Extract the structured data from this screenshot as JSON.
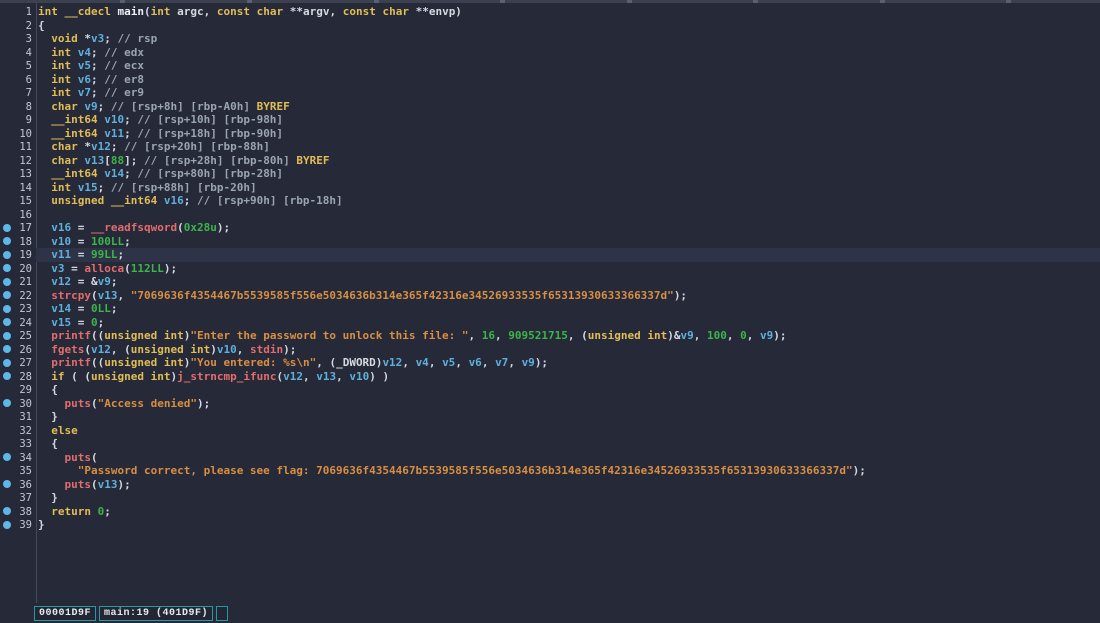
{
  "editor": {
    "current_line": 19,
    "breakpoints": [
      17,
      18,
      19,
      20,
      21,
      22,
      23,
      24,
      25,
      26,
      27,
      28,
      30,
      34,
      36,
      38,
      39
    ],
    "lines": [
      {
        "n": 1,
        "s": [
          [
            "kw",
            "int"
          ],
          [
            "pl",
            " "
          ],
          [
            "kw",
            "__cdecl"
          ],
          [
            "pl",
            " "
          ],
          [
            "mn",
            "main"
          ],
          [
            "pl",
            "("
          ],
          [
            "kw",
            "int"
          ],
          [
            "pl",
            " argc, "
          ],
          [
            "kw",
            "const"
          ],
          [
            "pl",
            " "
          ],
          [
            "kw",
            "char"
          ],
          [
            "pl",
            " **argv, "
          ],
          [
            "kw",
            "const"
          ],
          [
            "pl",
            " "
          ],
          [
            "kw",
            "char"
          ],
          [
            "pl",
            " **envp)"
          ]
        ]
      },
      {
        "n": 2,
        "s": [
          [
            "pl",
            "{"
          ]
        ]
      },
      {
        "n": 3,
        "s": [
          [
            "pl",
            "  "
          ],
          [
            "kw",
            "void"
          ],
          [
            "pl",
            " *"
          ],
          [
            "var",
            "v3"
          ],
          [
            "pl",
            "; "
          ],
          [
            "cm",
            "// rsp"
          ]
        ]
      },
      {
        "n": 4,
        "s": [
          [
            "pl",
            "  "
          ],
          [
            "kw",
            "int"
          ],
          [
            "pl",
            " "
          ],
          [
            "var",
            "v4"
          ],
          [
            "pl",
            "; "
          ],
          [
            "cm",
            "// edx"
          ]
        ]
      },
      {
        "n": 5,
        "s": [
          [
            "pl",
            "  "
          ],
          [
            "kw",
            "int"
          ],
          [
            "pl",
            " "
          ],
          [
            "var",
            "v5"
          ],
          [
            "pl",
            "; "
          ],
          [
            "cm",
            "// ecx"
          ]
        ]
      },
      {
        "n": 6,
        "s": [
          [
            "pl",
            "  "
          ],
          [
            "kw",
            "int"
          ],
          [
            "pl",
            " "
          ],
          [
            "var",
            "v6"
          ],
          [
            "pl",
            "; "
          ],
          [
            "cm",
            "// er8"
          ]
        ]
      },
      {
        "n": 7,
        "s": [
          [
            "pl",
            "  "
          ],
          [
            "kw",
            "int"
          ],
          [
            "pl",
            " "
          ],
          [
            "var",
            "v7"
          ],
          [
            "pl",
            "; "
          ],
          [
            "cm",
            "// er9"
          ]
        ]
      },
      {
        "n": 8,
        "s": [
          [
            "pl",
            "  "
          ],
          [
            "kw",
            "char"
          ],
          [
            "pl",
            " "
          ],
          [
            "var",
            "v9"
          ],
          [
            "pl",
            "; "
          ],
          [
            "cm",
            "// [rsp+8h] [rbp-A0h] "
          ],
          [
            "kw",
            "BYREF"
          ]
        ]
      },
      {
        "n": 9,
        "s": [
          [
            "pl",
            "  "
          ],
          [
            "kw",
            "__int64"
          ],
          [
            "pl",
            " "
          ],
          [
            "var",
            "v10"
          ],
          [
            "pl",
            "; "
          ],
          [
            "cm",
            "// [rsp+10h] [rbp-98h]"
          ]
        ]
      },
      {
        "n": 10,
        "s": [
          [
            "pl",
            "  "
          ],
          [
            "kw",
            "__int64"
          ],
          [
            "pl",
            " "
          ],
          [
            "var",
            "v11"
          ],
          [
            "pl",
            "; "
          ],
          [
            "cm",
            "// [rsp+18h] [rbp-90h]"
          ]
        ]
      },
      {
        "n": 11,
        "s": [
          [
            "pl",
            "  "
          ],
          [
            "kw",
            "char"
          ],
          [
            "pl",
            " *"
          ],
          [
            "var",
            "v12"
          ],
          [
            "pl",
            "; "
          ],
          [
            "cm",
            "// [rsp+20h] [rbp-88h]"
          ]
        ]
      },
      {
        "n": 12,
        "s": [
          [
            "pl",
            "  "
          ],
          [
            "kw",
            "char"
          ],
          [
            "pl",
            " "
          ],
          [
            "var",
            "v13"
          ],
          [
            "pl",
            "["
          ],
          [
            "num",
            "88"
          ],
          [
            "pl",
            "]; "
          ],
          [
            "cm",
            "// [rsp+28h] [rbp-80h] "
          ],
          [
            "kw",
            "BYREF"
          ]
        ]
      },
      {
        "n": 13,
        "s": [
          [
            "pl",
            "  "
          ],
          [
            "kw",
            "__int64"
          ],
          [
            "pl",
            " "
          ],
          [
            "var",
            "v14"
          ],
          [
            "pl",
            "; "
          ],
          [
            "cm",
            "// [rsp+80h] [rbp-28h]"
          ]
        ]
      },
      {
        "n": 14,
        "s": [
          [
            "pl",
            "  "
          ],
          [
            "kw",
            "int"
          ],
          [
            "pl",
            " "
          ],
          [
            "var",
            "v15"
          ],
          [
            "pl",
            "; "
          ],
          [
            "cm",
            "// [rsp+88h] [rbp-20h]"
          ]
        ]
      },
      {
        "n": 15,
        "s": [
          [
            "pl",
            "  "
          ],
          [
            "kw",
            "unsigned"
          ],
          [
            "pl",
            " "
          ],
          [
            "kw",
            "__int64"
          ],
          [
            "pl",
            " "
          ],
          [
            "var",
            "v16"
          ],
          [
            "pl",
            "; "
          ],
          [
            "cm",
            "// [rsp+90h] [rbp-18h]"
          ]
        ]
      },
      {
        "n": 16,
        "s": []
      },
      {
        "n": 17,
        "s": [
          [
            "pl",
            "  "
          ],
          [
            "var",
            "v16"
          ],
          [
            "pl",
            " = "
          ],
          [
            "fn",
            "__readfsqword"
          ],
          [
            "pl",
            "("
          ],
          [
            "num",
            "0x28u"
          ],
          [
            "pl",
            ");"
          ]
        ]
      },
      {
        "n": 18,
        "s": [
          [
            "pl",
            "  "
          ],
          [
            "var",
            "v10"
          ],
          [
            "pl",
            " = "
          ],
          [
            "num",
            "100LL"
          ],
          [
            "pl",
            ";"
          ]
        ]
      },
      {
        "n": 19,
        "s": [
          [
            "pl",
            "  "
          ],
          [
            "var",
            "v11"
          ],
          [
            "pl",
            " = "
          ],
          [
            "num",
            "99LL"
          ],
          [
            "pl",
            ";"
          ]
        ]
      },
      {
        "n": 20,
        "s": [
          [
            "pl",
            "  "
          ],
          [
            "var",
            "v3"
          ],
          [
            "pl",
            " = "
          ],
          [
            "fn",
            "alloca"
          ],
          [
            "pl",
            "("
          ],
          [
            "num",
            "112LL"
          ],
          [
            "pl",
            ");"
          ]
        ]
      },
      {
        "n": 21,
        "s": [
          [
            "pl",
            "  "
          ],
          [
            "var",
            "v12"
          ],
          [
            "pl",
            " = &"
          ],
          [
            "var",
            "v9"
          ],
          [
            "pl",
            ";"
          ]
        ]
      },
      {
        "n": 22,
        "s": [
          [
            "pl",
            "  "
          ],
          [
            "fn",
            "strcpy"
          ],
          [
            "pl",
            "("
          ],
          [
            "var",
            "v13"
          ],
          [
            "pl",
            ", "
          ],
          [
            "str",
            "\"7069636f4354467b5539585f556e5034636b314e365f42316e34526933535f65313930633366337d\""
          ],
          [
            "pl",
            ");"
          ]
        ]
      },
      {
        "n": 23,
        "s": [
          [
            "pl",
            "  "
          ],
          [
            "var",
            "v14"
          ],
          [
            "pl",
            " = "
          ],
          [
            "num",
            "0LL"
          ],
          [
            "pl",
            ";"
          ]
        ]
      },
      {
        "n": 24,
        "s": [
          [
            "pl",
            "  "
          ],
          [
            "var",
            "v15"
          ],
          [
            "pl",
            " = "
          ],
          [
            "num",
            "0"
          ],
          [
            "pl",
            ";"
          ]
        ]
      },
      {
        "n": 25,
        "s": [
          [
            "pl",
            "  "
          ],
          [
            "fn",
            "printf"
          ],
          [
            "pl",
            "(("
          ],
          [
            "kw",
            "unsigned"
          ],
          [
            "pl",
            " "
          ],
          [
            "kw",
            "int"
          ],
          [
            "pl",
            ")"
          ],
          [
            "str",
            "\"Enter the password to unlock this file: \""
          ],
          [
            "pl",
            ", "
          ],
          [
            "num",
            "16"
          ],
          [
            "pl",
            ", "
          ],
          [
            "num",
            "909521715"
          ],
          [
            "pl",
            ", ("
          ],
          [
            "kw",
            "unsigned"
          ],
          [
            "pl",
            " "
          ],
          [
            "kw",
            "int"
          ],
          [
            "pl",
            ")&"
          ],
          [
            "var",
            "v9"
          ],
          [
            "pl",
            ", "
          ],
          [
            "num",
            "100"
          ],
          [
            "pl",
            ", "
          ],
          [
            "num",
            "0"
          ],
          [
            "pl",
            ", "
          ],
          [
            "var",
            "v9"
          ],
          [
            "pl",
            ");"
          ]
        ]
      },
      {
        "n": 26,
        "s": [
          [
            "pl",
            "  "
          ],
          [
            "fn",
            "fgets"
          ],
          [
            "pl",
            "("
          ],
          [
            "var",
            "v12"
          ],
          [
            "pl",
            ", ("
          ],
          [
            "kw",
            "unsigned"
          ],
          [
            "pl",
            " "
          ],
          [
            "kw",
            "int"
          ],
          [
            "pl",
            ")"
          ],
          [
            "var",
            "v10"
          ],
          [
            "pl",
            ", "
          ],
          [
            "fn",
            "stdin"
          ],
          [
            "pl",
            ");"
          ]
        ]
      },
      {
        "n": 27,
        "s": [
          [
            "pl",
            "  "
          ],
          [
            "fn",
            "printf"
          ],
          [
            "pl",
            "(("
          ],
          [
            "kw",
            "unsigned"
          ],
          [
            "pl",
            " "
          ],
          [
            "kw",
            "int"
          ],
          [
            "pl",
            ")"
          ],
          [
            "str",
            "\"You entered: %s\\n\""
          ],
          [
            "pl",
            ", (_DWORD)"
          ],
          [
            "var",
            "v12"
          ],
          [
            "pl",
            ", "
          ],
          [
            "var",
            "v4"
          ],
          [
            "pl",
            ", "
          ],
          [
            "var",
            "v5"
          ],
          [
            "pl",
            ", "
          ],
          [
            "var",
            "v6"
          ],
          [
            "pl",
            ", "
          ],
          [
            "var",
            "v7"
          ],
          [
            "pl",
            ", "
          ],
          [
            "var",
            "v9"
          ],
          [
            "pl",
            ");"
          ]
        ]
      },
      {
        "n": 28,
        "s": [
          [
            "pl",
            "  "
          ],
          [
            "kw",
            "if"
          ],
          [
            "pl",
            " ( ("
          ],
          [
            "kw",
            "unsigned"
          ],
          [
            "pl",
            " "
          ],
          [
            "kw",
            "int"
          ],
          [
            "pl",
            ")"
          ],
          [
            "fn",
            "j_strncmp_ifunc"
          ],
          [
            "pl",
            "("
          ],
          [
            "var",
            "v12"
          ],
          [
            "pl",
            ", "
          ],
          [
            "var",
            "v13"
          ],
          [
            "pl",
            ", "
          ],
          [
            "var",
            "v10"
          ],
          [
            "pl",
            ") )"
          ]
        ]
      },
      {
        "n": 29,
        "s": [
          [
            "pl",
            "  {"
          ]
        ]
      },
      {
        "n": 30,
        "s": [
          [
            "pl",
            "    "
          ],
          [
            "fn",
            "puts"
          ],
          [
            "pl",
            "("
          ],
          [
            "str",
            "\"Access denied\""
          ],
          [
            "pl",
            ");"
          ]
        ]
      },
      {
        "n": 31,
        "s": [
          [
            "pl",
            "  }"
          ]
        ]
      },
      {
        "n": 32,
        "s": [
          [
            "pl",
            "  "
          ],
          [
            "kw",
            "else"
          ]
        ]
      },
      {
        "n": 33,
        "s": [
          [
            "pl",
            "  {"
          ]
        ]
      },
      {
        "n": 34,
        "s": [
          [
            "pl",
            "    "
          ],
          [
            "fn",
            "puts"
          ],
          [
            "pl",
            "("
          ]
        ]
      },
      {
        "n": 35,
        "s": [
          [
            "pl",
            "      "
          ],
          [
            "str",
            "\"Password correct, please see flag: 7069636f4354467b5539585f556e5034636b314e365f42316e34526933535f65313930633366337d\""
          ],
          [
            "pl",
            ");"
          ]
        ]
      },
      {
        "n": 36,
        "s": [
          [
            "pl",
            "    "
          ],
          [
            "fn",
            "puts"
          ],
          [
            "pl",
            "("
          ],
          [
            "var",
            "v13"
          ],
          [
            "pl",
            ");"
          ]
        ]
      },
      {
        "n": 37,
        "s": [
          [
            "pl",
            "  }"
          ]
        ]
      },
      {
        "n": 38,
        "s": [
          [
            "pl",
            "  "
          ],
          [
            "kw",
            "return"
          ],
          [
            "pl",
            " "
          ],
          [
            "num",
            "0"
          ],
          [
            "pl",
            ";"
          ]
        ]
      },
      {
        "n": 39,
        "s": [
          [
            "pl",
            "}"
          ]
        ]
      }
    ]
  },
  "status_bar": {
    "address": "00001D9F",
    "location": "main:19 (401D9F)"
  },
  "colors": {
    "background": "#252938",
    "line_highlight": "#2e3347",
    "keyword": "#e2bd55",
    "variable": "#5fb0dc",
    "function": "#e26d6d",
    "number": "#3cb54a",
    "string": "#d98f42",
    "comment": "#9ba4b2",
    "plain": "#d5d9e0",
    "breakpoint_dot": "#5cb8e8",
    "status_border": "#2b97a5"
  }
}
